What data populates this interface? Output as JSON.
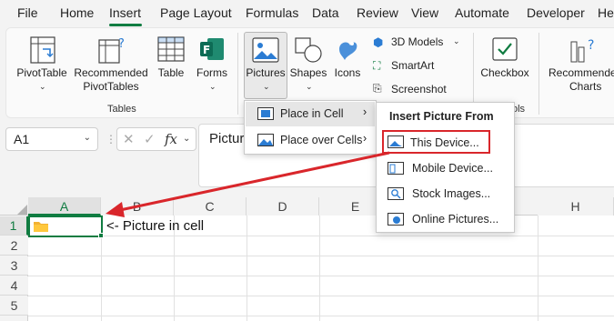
{
  "menubar": {
    "tabs": [
      "File",
      "Home",
      "Insert",
      "Page Layout",
      "Formulas",
      "Data",
      "Review",
      "View",
      "Automate",
      "Developer",
      "He"
    ],
    "active_tab": "Insert"
  },
  "ribbon": {
    "pivottable": "PivotTable",
    "recommended_pivot_1": "Recommended",
    "recommended_pivot_2": "PivotTables",
    "table": "Table",
    "forms": "Forms",
    "tables_group": "Tables",
    "pictures": "Pictures",
    "shapes": "Shapes",
    "icons": "Icons",
    "models_3d": "3D Models",
    "smartart": "SmartArt",
    "screenshot": "Screenshot",
    "checkbox": "Checkbox",
    "controls_group_fragment": "ols",
    "recommended_charts_1": "Recommende",
    "recommended_charts_2": "Charts"
  },
  "formula_bar": {
    "name_box": "A1",
    "fx": "fx",
    "content": "Pictur"
  },
  "pictures_menu": {
    "place_in_cell": "Place in Cell",
    "place_over_cells": "Place over Cells"
  },
  "insert_picture_menu": {
    "header": "Insert Picture From",
    "items": [
      "This Device...",
      "Mobile Device...",
      "Stock Images...",
      "Online Pictures..."
    ]
  },
  "grid": {
    "columns": [
      "A",
      "B",
      "C",
      "D",
      "E",
      "H"
    ],
    "rows": [
      "1",
      "2",
      "3",
      "4",
      "5"
    ],
    "cell_b1": "<- Picture in cell"
  },
  "colors": {
    "accent_green": "#107c41",
    "annotation_red": "#d9262b"
  }
}
